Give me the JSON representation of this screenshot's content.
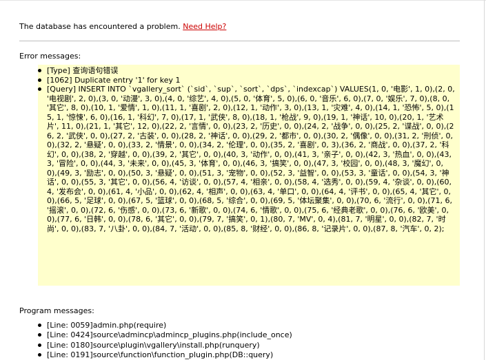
{
  "intro": {
    "message": "The database has encountered a problem.",
    "help_link": "Need Help?"
  },
  "error_section": {
    "title": "Error messages:",
    "items": [
      "[Type] 查询语句错误",
      "[1062] Duplicate entry '1' for key 1",
      "[Query] INSERT INTO `vgallery_sort` (`sid`, `sup`, `sort`, `dps`, `indexcap`) VALUES(1, 0, '电影', 1, 0),(2, 0, '电视剧', 2, 0),(3, 0, '动漫', 3, 0),(4, 0, '综艺', 4, 0),(5, 0, '体育', 5, 0),(6, 0, '音乐', 6, 0),(7, 0, '娱乐', 7, 0),(8, 0, '其它', 8, 0),(10, 1, '爱情', 1, 0),(11, 1, '喜剧', 2, 0),(12, 1, '动作', 3, 0),(13, 1, '灾难', 4, 0),(14, 1, '恐怖', 5, 0),(15, 1, '惊悚', 6, 0),(16, 1, '科幻', 7, 0),(17, 1, '武侠', 8, 0),(18, 1, '枪战', 9, 0),(19, 1, '神话', 10, 0),(20, 1, '艺术片', 11, 0),(21, 1, '其它', 12, 0),(22, 2, '言情', 0, 0),(23, 2, '历史', 0, 0),(24, 2, '战争', 0, 0),(25, 2, '谍战', 0, 0),(26, 2, '武侠', 0, 0),(27, 2, '古装', 0, 0),(28, 2, '神话', 0, 0),(29, 2, '都市', 0, 0),(30, 2, '偶像', 0, 0),(31, 2, '刑侦', 0, 0),(32, 2, '悬疑', 0, 0),(33, 2, '情景', 0, 0),(34, 2, '伦理', 0, 0),(35, 2, '喜剧', 0, 3),(36, 2, '商战', 0, 0),(37, 2, '科幻', 0, 0),(38, 2, '穿越', 0, 0),(39, 2, '其它', 0, 0),(40, 3, '动作', 0, 0),(41, 3, '亲子', 0, 0),(42, 3, '热血', 0, 0),(43, 3, '冒险', 0, 0),(44, 3, '未来', 0, 0),(45, 3, '体育', 0, 0),(46, 3, '搞笑', 0, 0),(47, 3, '校园', 0, 0),(48, 3, '魔幻', 0, 0),(49, 3, '励志', 0, 0),(50, 3, '悬疑', 0, 0),(51, 3, '宠物', 0, 0),(52, 3, '益智', 0, 0),(53, 3, '童话', 0, 0),(54, 3, '神话', 0, 0),(55, 3, '其它', 0, 0),(56, 4, '访谈', 0, 0),(57, 4, '相亲', 0, 0),(58, 4, '选秀', 0, 0),(59, 4, '杂谈', 0, 0),(60, 4, '发布会', 0, 0),(61, 4, '小品', 0, 0),(62, 4, '相声', 0, 0),(63, 4, '单口', 0, 0),(64, 4, '评书', 0, 0),(65, 4, '其它', 0, 0),(66, 5, '足球', 0, 0),(67, 5, '篮球', 0, 0),(68, 5, '综合', 0, 0),(69, 5, '体坛聚集', 0, 0),(70, 6, '流行', 0, 0),(71, 6, '摇滚', 0, 0),(72, 6, '伤感', 0, 0),(73, 6, '新歌', 0, 0),(74, 6, '情歌', 0, 0),(75, 6, '经典老歌', 0, 0),(76, 6, '欧美', 0, 0),(77, 6, '日韩', 0, 0),(78, 6, '其它', 0, 0),(79, 7, '搞笑', 0, 1),(80, 7, 'MV', 0, 4),(81, 7, '明星', 0, 0),(82, 7, '时尚', 0, 0),(83, 7, '八卦', 0, 0),(84, 7, '活动', 0, 0),(85, 8, '财经', 0, 0),(86, 8, '记录片', 0, 0),(87, 8, '汽车', 0, 2);"
    ]
  },
  "program_section": {
    "title": "Program messages:",
    "items": [
      "[Line: 0059]admin.php(require)",
      "[Line: 0424]source\\admincp\\admincp_plugins.php(include_once)",
      "[Line: 0180]source\\plugin\\vgallery\\install.php(runquery)",
      "[Line: 0191]source\\function\\function_plugin.php(DB::query)"
    ]
  },
  "colors": {
    "link": "#cc0000",
    "error_background": "#ffffcc",
    "divider": "#bdbdbd"
  }
}
